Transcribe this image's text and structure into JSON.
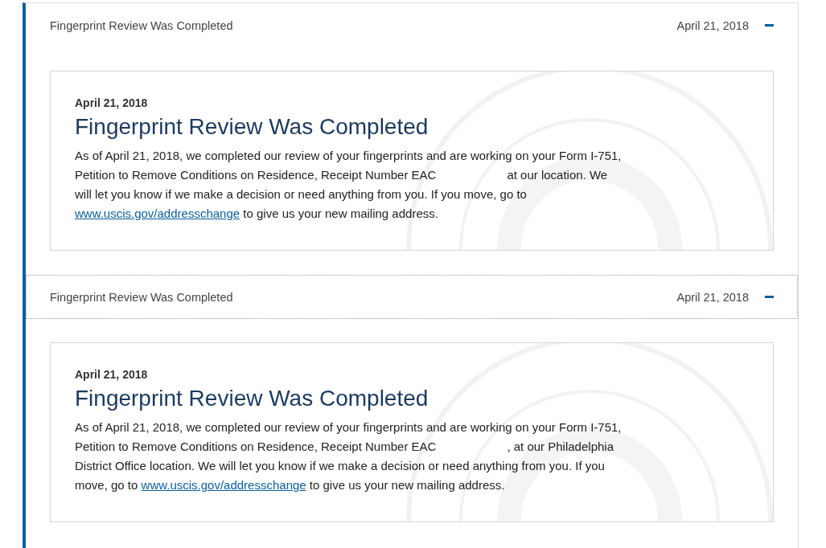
{
  "events": [
    {
      "title": "Fingerprint Review Was Completed",
      "date": "April 21, 2018",
      "expanded": true,
      "focused": false,
      "detail": {
        "date": "April 21, 2018",
        "title": "Fingerprint Review Was Completed",
        "text_before": "As of April 21, 2018, we completed our review of your fingerprints and are working on your Form I-751, Petition to Remove Conditions on Residence, Receipt Number EAC",
        "redacted": true,
        "text_after": "at our location. We will let you know if we make a decision or need anything from you. If you move, go to",
        "link": "www.uscis.gov/addresschange",
        "text_end": "to give us your new mailing address."
      }
    },
    {
      "title": "Fingerprint Review Was Completed",
      "date": "April 21, 2018",
      "expanded": true,
      "focused": true,
      "detail": {
        "date": "April 21, 2018",
        "title": "Fingerprint Review Was Completed",
        "text_before": "As of April 21, 2018, we completed our review of your fingerprints and are working on your Form I-751, Petition to Remove Conditions on Residence, Receipt Number EAC",
        "redacted": true,
        "text_after": ", at our Philadelphia District Office location. We will let you know if we make a decision or need anything from you. If you move, go to",
        "link": "www.uscis.gov/addresschange",
        "text_end": "to give us your new mailing address."
      }
    }
  ]
}
